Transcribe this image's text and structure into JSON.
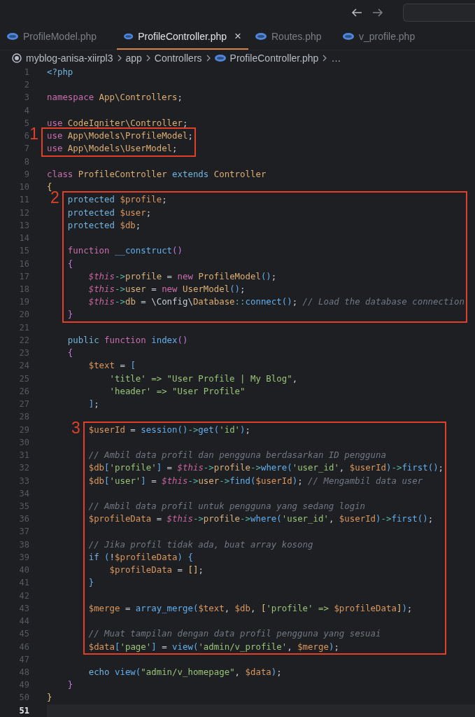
{
  "tabs": [
    {
      "label": "ProfileModel.php",
      "selected": false
    },
    {
      "label": "ProfileController.php",
      "selected": true,
      "close": "×"
    },
    {
      "label": "Routes.php",
      "selected": false
    },
    {
      "label": "v_profile.php",
      "selected": false
    }
  ],
  "breadcrumb": {
    "items": [
      "myblog-anisa-xiirpl3",
      "app",
      "Controllers",
      "ProfileController.php"
    ],
    "more": "…"
  },
  "code": [
    {
      "kind": "plain",
      "lines": [
        {
          "number": "1",
          "active": false,
          "tokens": [
            {
              "t": "<?php",
              "kind": "tag"
            }
          ]
        },
        {
          "number": "2",
          "active": false
        },
        {
          "number": "3",
          "active": false,
          "tokens": [
            {
              "t": "namespace",
              "kind": "kw"
            },
            {
              "t": " App\\Controllers",
              "kind": "cls"
            },
            {
              "t": ";",
              "kind": "p"
            }
          ]
        },
        {
          "number": "4",
          "active": false
        },
        {
          "number": "5",
          "active": false,
          "tokens": [
            {
              "t": "use",
              "kind": "kw"
            },
            {
              "t": " CodeIgniter\\Controller",
              "kind": "cls"
            },
            {
              "t": ";",
              "kind": "p"
            }
          ]
        }
      ]
    },
    {
      "kind": "boxed",
      "label": "1",
      "lines": [
        {
          "number": "6",
          "active": false,
          "tokens": [
            {
              "t": "use",
              "kind": "kw"
            },
            {
              "t": " App\\Models\\ProfileModel",
              "kind": "cls"
            },
            {
              "t": ";",
              "kind": "p"
            }
          ]
        },
        {
          "number": "7",
          "active": false,
          "tokens": [
            {
              "t": "use",
              "kind": "kw"
            },
            {
              "t": " App\\Models\\UserModel",
              "kind": "cls"
            },
            {
              "t": ";",
              "kind": "p"
            }
          ]
        }
      ]
    },
    {
      "kind": "plain",
      "lines": [
        {
          "number": "8",
          "active": false
        },
        {
          "number": "9",
          "active": false,
          "tokens": [
            {
              "t": "class",
              "kind": "kw"
            },
            {
              "t": " ProfileController",
              "kind": "cls"
            },
            {
              "t": " extends",
              "kind": "kw2"
            },
            {
              "t": " Controller",
              "kind": "cls"
            }
          ]
        },
        {
          "number": "10",
          "active": false,
          "tokens": [
            {
              "t": "{",
              "kind": "b1"
            }
          ]
        }
      ]
    },
    {
      "kind": "boxed",
      "label": "2",
      "lines": [
        {
          "number": "11",
          "active": false,
          "tokens": [
            {
              "t": "    protected",
              "kind": "kw2"
            },
            {
              "t": " $profile",
              "kind": "var"
            },
            {
              "t": ";",
              "kind": "p"
            }
          ]
        },
        {
          "number": "12",
          "active": false,
          "tokens": [
            {
              "t": "    protected",
              "kind": "kw2"
            },
            {
              "t": " $user",
              "kind": "var"
            },
            {
              "t": ";",
              "kind": "p"
            }
          ]
        },
        {
          "number": "13",
          "active": false,
          "tokens": [
            {
              "t": "    protected",
              "kind": "kw2"
            },
            {
              "t": " $db",
              "kind": "var"
            },
            {
              "t": ";",
              "kind": "p"
            }
          ]
        },
        {
          "number": "14",
          "active": false
        },
        {
          "number": "15",
          "active": false,
          "tokens": [
            {
              "t": "    function",
              "kind": "kw"
            },
            {
              "t": " __construct",
              "kind": "fn"
            },
            {
              "t": "()",
              "kind": "b2"
            }
          ]
        },
        {
          "number": "16",
          "active": false,
          "tokens": [
            {
              "t": "    {",
              "kind": "b2"
            }
          ]
        },
        {
          "number": "17",
          "active": false,
          "tokens": [
            {
              "t": "        $this",
              "kind": "this"
            },
            {
              "t": "->",
              "kind": "op"
            },
            {
              "t": "profile",
              "kind": "prop"
            },
            {
              "t": " = ",
              "kind": "p"
            },
            {
              "t": "new",
              "kind": "kw"
            },
            {
              "t": " ProfileModel",
              "kind": "cls"
            },
            {
              "t": "()",
              "kind": "b3"
            },
            {
              "t": ";",
              "kind": "p"
            }
          ]
        },
        {
          "number": "18",
          "active": false,
          "tokens": [
            {
              "t": "        $this",
              "kind": "this"
            },
            {
              "t": "->",
              "kind": "op"
            },
            {
              "t": "user",
              "kind": "prop"
            },
            {
              "t": " = ",
              "kind": "p"
            },
            {
              "t": "new",
              "kind": "kw"
            },
            {
              "t": " UserModel",
              "kind": "cls"
            },
            {
              "t": "()",
              "kind": "b3"
            },
            {
              "t": ";",
              "kind": "p"
            }
          ]
        },
        {
          "number": "19",
          "active": false,
          "tokens": [
            {
              "t": "        $this",
              "kind": "this"
            },
            {
              "t": "->",
              "kind": "op"
            },
            {
              "t": "db",
              "kind": "prop"
            },
            {
              "t": " = \\Config\\",
              "kind": "p"
            },
            {
              "t": "Database",
              "kind": "cls"
            },
            {
              "t": "::",
              "kind": "op"
            },
            {
              "t": "connect",
              "kind": "fn"
            },
            {
              "t": "()",
              "kind": "b3"
            },
            {
              "t": ";",
              "kind": "p"
            },
            {
              "t": " // Load the database connection",
              "kind": "cmt"
            }
          ]
        },
        {
          "number": "20",
          "active": false,
          "tokens": [
            {
              "t": "    }",
              "kind": "b2"
            }
          ]
        }
      ]
    },
    {
      "kind": "plain",
      "lines": [
        {
          "number": "21",
          "active": false
        },
        {
          "number": "22",
          "active": false,
          "tokens": [
            {
              "t": "    public",
              "kind": "kw2"
            },
            {
              "t": " function",
              "kind": "kw"
            },
            {
              "t": " index",
              "kind": "fn"
            },
            {
              "t": "()",
              "kind": "b2"
            }
          ]
        },
        {
          "number": "23",
          "active": false,
          "tokens": [
            {
              "t": "    {",
              "kind": "b2"
            }
          ]
        },
        {
          "number": "24",
          "active": false,
          "tokens": [
            {
              "t": "        $text",
              "kind": "var"
            },
            {
              "t": " = ",
              "kind": "p"
            },
            {
              "t": "[",
              "kind": "b3"
            }
          ]
        },
        {
          "number": "25",
          "active": false,
          "tokens": [
            {
              "t": "            'title' => \"User Profile | My Blog\"",
              "kind": "str"
            },
            {
              "t": ",",
              "kind": "p"
            }
          ]
        },
        {
          "number": "26",
          "active": false,
          "tokens": [
            {
              "t": "            'header' => \"User Profile\"",
              "kind": "str"
            }
          ]
        },
        {
          "number": "27",
          "active": false,
          "tokens": [
            {
              "t": "        ]",
              "kind": "b3"
            },
            {
              "t": ";",
              "kind": "p"
            }
          ]
        },
        {
          "number": "28",
          "active": false
        }
      ]
    },
    {
      "kind": "boxed",
      "label": "3",
      "lines": [
        {
          "number": "29",
          "active": false,
          "tokens": [
            {
              "t": "        $userId",
              "kind": "var"
            },
            {
              "t": " = ",
              "kind": "p"
            },
            {
              "t": "session",
              "kind": "fn"
            },
            {
              "t": "()",
              "kind": "b3"
            },
            {
              "t": "->",
              "kind": "op"
            },
            {
              "t": "get",
              "kind": "fn"
            },
            {
              "t": "(",
              "kind": "b3"
            },
            {
              "t": "'id'",
              "kind": "str"
            },
            {
              "t": ")",
              "kind": "b3"
            },
            {
              "t": ";",
              "kind": "p"
            }
          ]
        },
        {
          "number": "30",
          "active": false
        },
        {
          "number": "31",
          "active": false,
          "tokens": [
            {
              "t": "        // Ambil data profil dan pengguna berdasarkan ID pengguna",
              "kind": "cmt"
            }
          ]
        },
        {
          "number": "32",
          "active": false,
          "tokens": [
            {
              "t": "        $db",
              "kind": "var"
            },
            {
              "t": "[",
              "kind": "b3"
            },
            {
              "t": "'profile'",
              "kind": "str"
            },
            {
              "t": "]",
              "kind": "b3"
            },
            {
              "t": " = ",
              "kind": "p"
            },
            {
              "t": "$this",
              "kind": "this"
            },
            {
              "t": "->",
              "kind": "op"
            },
            {
              "t": "profile",
              "kind": "prop"
            },
            {
              "t": "->",
              "kind": "op"
            },
            {
              "t": "where",
              "kind": "fn"
            },
            {
              "t": "(",
              "kind": "b3"
            },
            {
              "t": "'user_id'",
              "kind": "str"
            },
            {
              "t": ", ",
              "kind": "p"
            },
            {
              "t": "$userId",
              "kind": "var"
            },
            {
              "t": ")",
              "kind": "b3"
            },
            {
              "t": "->",
              "kind": "op"
            },
            {
              "t": "first",
              "kind": "fn"
            },
            {
              "t": "()",
              "kind": "b3"
            },
            {
              "t": ";",
              "kind": "p"
            }
          ]
        },
        {
          "number": "33",
          "active": false,
          "tokens": [
            {
              "t": "        $db",
              "kind": "var"
            },
            {
              "t": "[",
              "kind": "b3"
            },
            {
              "t": "'user'",
              "kind": "str"
            },
            {
              "t": "]",
              "kind": "b3"
            },
            {
              "t": " = ",
              "kind": "p"
            },
            {
              "t": "$this",
              "kind": "this"
            },
            {
              "t": "->",
              "kind": "op"
            },
            {
              "t": "user",
              "kind": "prop"
            },
            {
              "t": "->",
              "kind": "op"
            },
            {
              "t": "find",
              "kind": "fn"
            },
            {
              "t": "(",
              "kind": "b3"
            },
            {
              "t": "$userId",
              "kind": "var"
            },
            {
              "t": ")",
              "kind": "b3"
            },
            {
              "t": ";",
              "kind": "p"
            },
            {
              "t": " // Mengambil data user",
              "kind": "cmt"
            }
          ]
        },
        {
          "number": "34",
          "active": false
        },
        {
          "number": "35",
          "active": false,
          "tokens": [
            {
              "t": "        // Ambil data profil untuk pengguna yang sedang login",
              "kind": "cmt"
            }
          ]
        },
        {
          "number": "36",
          "active": false,
          "tokens": [
            {
              "t": "        $profileData",
              "kind": "var"
            },
            {
              "t": " = ",
              "kind": "p"
            },
            {
              "t": "$this",
              "kind": "this"
            },
            {
              "t": "->",
              "kind": "op"
            },
            {
              "t": "profile",
              "kind": "prop"
            },
            {
              "t": "->",
              "kind": "op"
            },
            {
              "t": "where",
              "kind": "fn"
            },
            {
              "t": "(",
              "kind": "b3"
            },
            {
              "t": "'user_id'",
              "kind": "str"
            },
            {
              "t": ", ",
              "kind": "p"
            },
            {
              "t": "$userId",
              "kind": "var"
            },
            {
              "t": ")",
              "kind": "b3"
            },
            {
              "t": "->",
              "kind": "op"
            },
            {
              "t": "first",
              "kind": "fn"
            },
            {
              "t": "()",
              "kind": "b3"
            },
            {
              "t": ";",
              "kind": "p"
            }
          ]
        },
        {
          "number": "37",
          "active": false
        },
        {
          "number": "38",
          "active": false,
          "tokens": [
            {
              "t": "        // Jika profil tidak ada, buat array kosong",
              "kind": "cmt"
            }
          ]
        },
        {
          "number": "39",
          "active": false,
          "tokens": [
            {
              "t": "        if",
              "kind": "kw2"
            },
            {
              "t": " (",
              "kind": "b3"
            },
            {
              "t": "!",
              "kind": "p"
            },
            {
              "t": "$profileData",
              "kind": "var"
            },
            {
              "t": ")",
              "kind": "b3"
            },
            {
              "t": " {",
              "kind": "b3"
            }
          ]
        },
        {
          "number": "40",
          "active": false,
          "tokens": [
            {
              "t": "            $profileData",
              "kind": "var"
            },
            {
              "t": " = ",
              "kind": "p"
            },
            {
              "t": "[]",
              "kind": "b1"
            },
            {
              "t": ";",
              "kind": "p"
            }
          ]
        },
        {
          "number": "41",
          "active": false,
          "tokens": [
            {
              "t": "        }",
              "kind": "b3"
            }
          ]
        },
        {
          "number": "42",
          "active": false
        },
        {
          "number": "43",
          "active": false,
          "tokens": [
            {
              "t": "        $merge",
              "kind": "var"
            },
            {
              "t": " = ",
              "kind": "p"
            },
            {
              "t": "array_merge",
              "kind": "fn"
            },
            {
              "t": "(",
              "kind": "b3"
            },
            {
              "t": "$text",
              "kind": "var"
            },
            {
              "t": ", ",
              "kind": "p"
            },
            {
              "t": "$db",
              "kind": "var"
            },
            {
              "t": ", ",
              "kind": "p"
            },
            {
              "t": "[",
              "kind": "b1"
            },
            {
              "t": "'profile' =>",
              "kind": "str"
            },
            {
              "t": " $profileData",
              "kind": "var"
            },
            {
              "t": "]",
              "kind": "b1"
            },
            {
              "t": ")",
              "kind": "b3"
            },
            {
              "t": ";",
              "kind": "p"
            }
          ]
        },
        {
          "number": "44",
          "active": false
        },
        {
          "number": "45",
          "active": false,
          "tokens": [
            {
              "t": "        // Muat tampilan dengan data profil pengguna yang sesuai",
              "kind": "cmt"
            }
          ]
        },
        {
          "number": "46",
          "active": false,
          "tokens": [
            {
              "t": "        $data",
              "kind": "var"
            },
            {
              "t": "[",
              "kind": "b3"
            },
            {
              "t": "'page'",
              "kind": "str"
            },
            {
              "t": "]",
              "kind": "b3"
            },
            {
              "t": " = ",
              "kind": "p"
            },
            {
              "t": "view",
              "kind": "fn"
            },
            {
              "t": "(",
              "kind": "b3"
            },
            {
              "t": "'admin/v_profile'",
              "kind": "str"
            },
            {
              "t": ", ",
              "kind": "p"
            },
            {
              "t": "$merge",
              "kind": "var"
            },
            {
              "t": ")",
              "kind": "b3"
            },
            {
              "t": ";",
              "kind": "p"
            }
          ]
        }
      ]
    },
    {
      "kind": "plain",
      "lines": [
        {
          "number": "47",
          "active": false
        },
        {
          "number": "48",
          "active": false,
          "tokens": [
            {
              "t": "        echo",
              "kind": "kw2"
            },
            {
              "t": " view",
              "kind": "fn"
            },
            {
              "t": "(",
              "kind": "b3"
            },
            {
              "t": "\"admin/v_homepage\"",
              "kind": "str"
            },
            {
              "t": ", ",
              "kind": "p"
            },
            {
              "t": "$data",
              "kind": "var"
            },
            {
              "t": ")",
              "kind": "b3"
            },
            {
              "t": ";",
              "kind": "p"
            }
          ]
        },
        {
          "number": "49",
          "active": false,
          "tokens": [
            {
              "t": "    }",
              "kind": "b2"
            }
          ]
        },
        {
          "number": "50",
          "active": false,
          "tokens": [
            {
              "t": "}",
              "kind": "b1"
            }
          ]
        },
        {
          "number": "51",
          "active": true
        }
      ]
    }
  ]
}
